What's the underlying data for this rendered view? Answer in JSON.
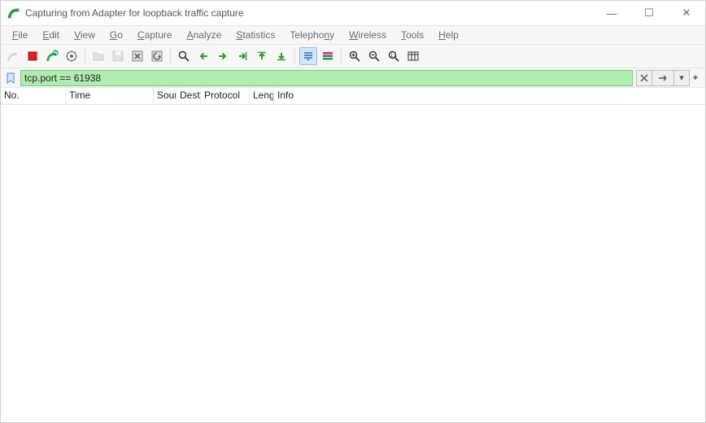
{
  "window": {
    "title": "Capturing from Adapter for loopback traffic capture"
  },
  "menu": {
    "items": [
      {
        "label": "File",
        "ul": 0
      },
      {
        "label": "Edit",
        "ul": 0
      },
      {
        "label": "View",
        "ul": 0
      },
      {
        "label": "Go",
        "ul": 0
      },
      {
        "label": "Capture",
        "ul": 0
      },
      {
        "label": "Analyze",
        "ul": 0
      },
      {
        "label": "Statistics",
        "ul": 0
      },
      {
        "label": "Telephony",
        "ul": 7
      },
      {
        "label": "Wireless",
        "ul": 0
      },
      {
        "label": "Tools",
        "ul": 0
      },
      {
        "label": "Help",
        "ul": 0
      }
    ]
  },
  "filter": {
    "value": "tcp.port == 61938"
  },
  "columns": {
    "no": "No.",
    "time": "Time",
    "source": "Sour",
    "dest": "Dest",
    "proto": "Protocol",
    "len": "Leng",
    "info": "Info"
  },
  "win_controls": {
    "min": "—",
    "max": "☐",
    "close": "✕"
  }
}
